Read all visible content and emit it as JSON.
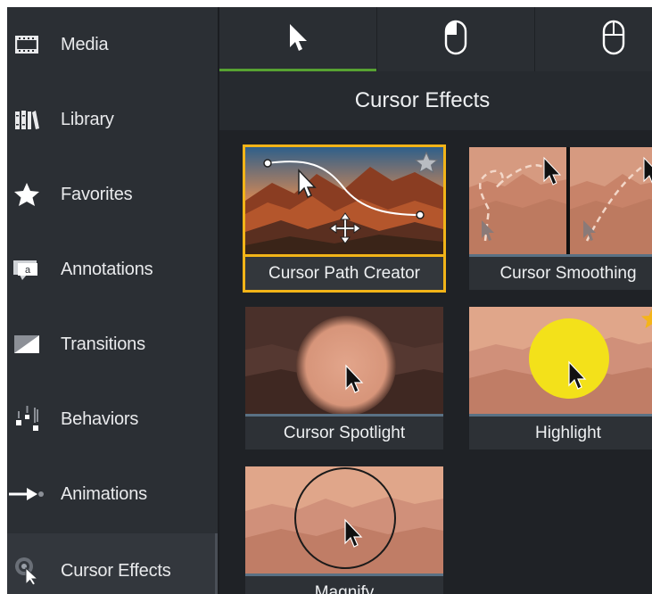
{
  "sidebar": {
    "items": [
      {
        "label": "Media",
        "icon": "film-icon"
      },
      {
        "label": "Library",
        "icon": "books-icon"
      },
      {
        "label": "Favorites",
        "icon": "star-icon"
      },
      {
        "label": "Annotations",
        "icon": "callout-icon"
      },
      {
        "label": "Transitions",
        "icon": "transition-icon"
      },
      {
        "label": "Behaviors",
        "icon": "behaviors-icon"
      },
      {
        "label": "Animations",
        "icon": "animation-arrow-icon"
      },
      {
        "label": "Cursor Effects",
        "icon": "cursor-effects-icon",
        "active": true
      }
    ]
  },
  "tabs": [
    {
      "icon": "pointer-icon",
      "active": true
    },
    {
      "icon": "left-click-mouse-icon"
    },
    {
      "icon": "right-click-mouse-icon"
    }
  ],
  "panel": {
    "title": "Cursor Effects"
  },
  "effects": [
    {
      "label": "Cursor Path Creator",
      "selected": true,
      "favorite": true
    },
    {
      "label": "Cursor Smoothing"
    },
    {
      "label": "Cursor Spotlight"
    },
    {
      "label": "Highlight",
      "favorite": true
    },
    {
      "label": "Magnify"
    }
  ],
  "colors": {
    "accent_green": "#57a232",
    "selection_gold": "#f2b418",
    "favorite_star": "#f4b41a"
  }
}
